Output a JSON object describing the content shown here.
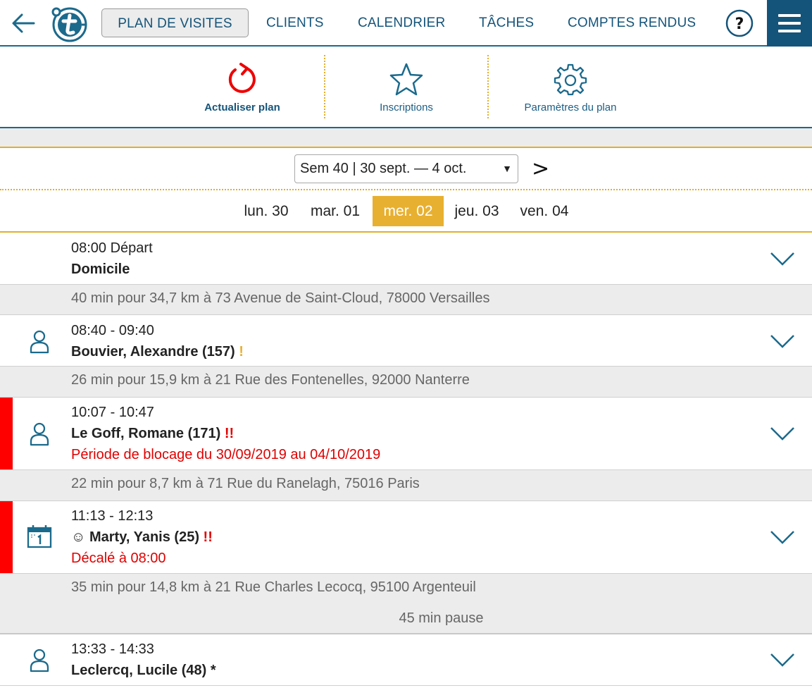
{
  "nav": {
    "tabs": [
      {
        "label": "PLAN DE VISITES",
        "active": true
      },
      {
        "label": "CLIENTS"
      },
      {
        "label": "CALENDRIER"
      },
      {
        "label": "TÂCHES"
      },
      {
        "label": "COMPTES RENDUS"
      }
    ],
    "help": "?"
  },
  "toolbar": {
    "refresh_label": "Actualiser plan",
    "subscriptions_label": "Inscriptions",
    "settings_label": "Paramètres du plan"
  },
  "week": {
    "selected": "Sem 40 | 30 sept. — 4 oct.",
    "caret": "▼",
    "next": ">"
  },
  "days": [
    {
      "label": "lun. 30"
    },
    {
      "label": "mar. 01"
    },
    {
      "label": "mer. 02",
      "active": true
    },
    {
      "label": "jeu. 03"
    },
    {
      "label": "ven. 04"
    }
  ],
  "visits": [
    {
      "time": "08:00 Départ",
      "name": "Domicile"
    },
    {
      "time": "08:40 - 09:40",
      "name": "Bouvier, Alexandre (157)",
      "mark": "!"
    },
    {
      "time": "10:07 - 10:47",
      "name": "Le Goff, Romane (171)",
      "mark": "!!",
      "warning": "Période de blocage du 30/09/2019 au 04/10/2019"
    },
    {
      "time": "11:13 - 12:13",
      "prefix": "☺",
      "name": "Marty, Yanis (25)",
      "mark": "!!",
      "warning": "Décalé à 08:00"
    },
    {
      "time": "13:33 - 14:33",
      "name": "Leclercq, Lucile (48) *"
    }
  ],
  "routes": [
    {
      "text": "40 min pour 34,7 km à 73 Avenue de Saint-Cloud, 78000 Versailles"
    },
    {
      "text": "26 min pour 15,9 km à 21 Rue des Fontenelles, 92000 Nanterre"
    },
    {
      "text": "22 min pour 8,7 km à 71 Rue du Ranelagh, 75016 Paris"
    },
    {
      "text": "35 min pour 14,8 km à 21 Rue Charles Lecocq, 95100 Argenteuil",
      "pause": "45 min pause"
    }
  ],
  "colors": {
    "brand_blue": "#14547a",
    "accent_yellow": "#e8b030",
    "alert_red": "#ff0000"
  }
}
